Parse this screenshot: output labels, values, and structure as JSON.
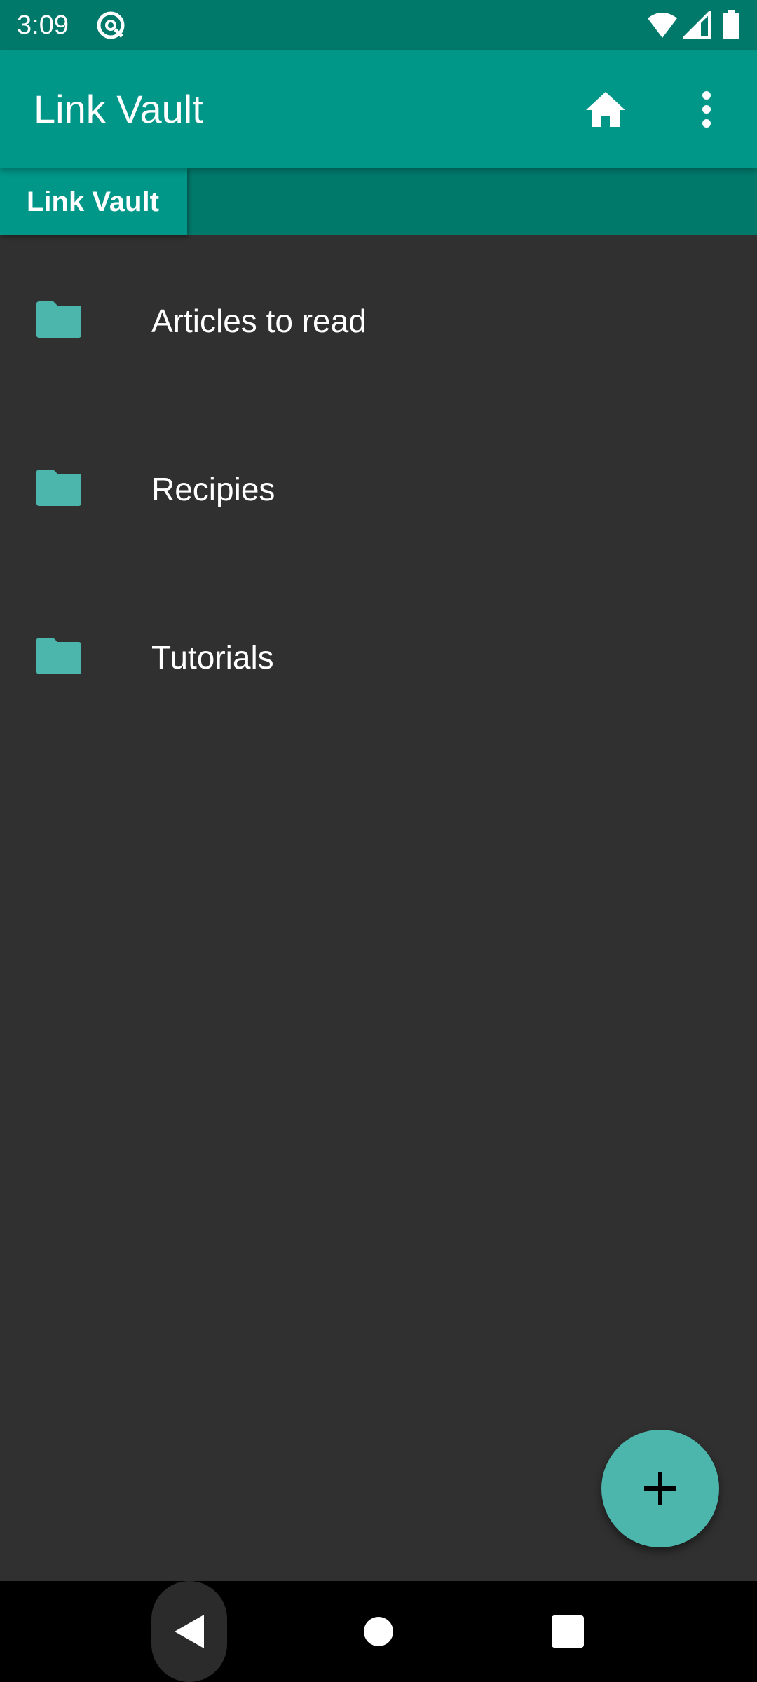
{
  "status_bar": {
    "time": "3:09",
    "app_icon": "at-sign-icon",
    "icons": [
      "wifi-icon",
      "cell-signal-icon",
      "battery-icon"
    ]
  },
  "app_bar": {
    "title": "Link Vault",
    "actions": [
      "home-icon",
      "more-vert-icon"
    ]
  },
  "breadcrumb": {
    "items": [
      "Link Vault"
    ]
  },
  "folders": [
    {
      "label": "Articles to read",
      "icon": "folder-icon"
    },
    {
      "label": "Recipies",
      "icon": "folder-icon"
    },
    {
      "label": "Tutorials",
      "icon": "folder-icon"
    }
  ],
  "fab": {
    "icon": "add-icon"
  },
  "nav_bar": {
    "buttons": [
      "back-icon",
      "home-circle-icon",
      "recents-square-icon"
    ]
  },
  "colors": {
    "primary": "#009688",
    "primary_dark": "#00796b",
    "accent": "#4db6ac",
    "background": "#303030",
    "folder_icon": "#4db6ac"
  }
}
